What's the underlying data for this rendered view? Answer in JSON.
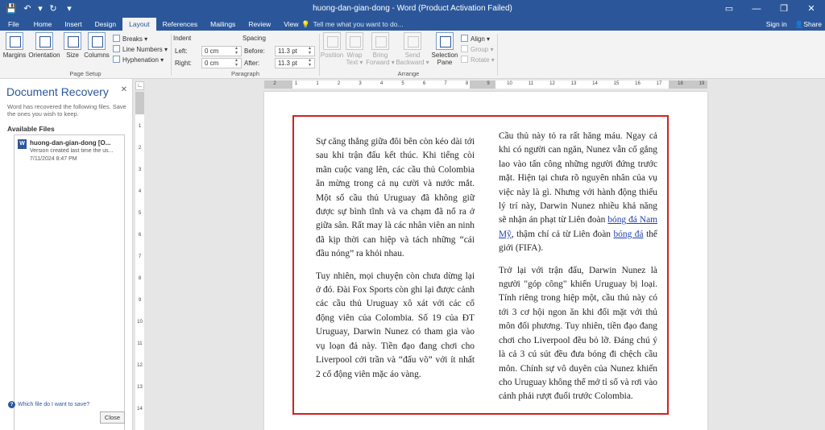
{
  "titlebar": {
    "title": "huong-dan-gian-dong - Word (Product Activation Failed)",
    "qat": {
      "save_glyph": "💾",
      "undo_glyph": "↶",
      "undo_drop": "▾",
      "redo_glyph": "↻",
      "customize_glyph": "▾"
    },
    "controls": {
      "ribbon_opts": "▭",
      "minimize": "—",
      "restore": "❐",
      "close": "✕"
    }
  },
  "tabs": [
    "File",
    "Home",
    "Insert",
    "Design",
    "Layout",
    "References",
    "Mailings",
    "Review",
    "View"
  ],
  "active_tab": "Layout",
  "tell_me": {
    "icon": "💡",
    "text": "Tell me what you want to do..."
  },
  "account": {
    "sign_in": "Sign in",
    "share": "Share",
    "share_icon": "👤"
  },
  "ribbon": {
    "page_setup": {
      "margins": "Margins",
      "orientation": "Orientation",
      "size": "Size",
      "columns": "Columns",
      "breaks": "Breaks ▾",
      "line_numbers": "Line Numbers ▾",
      "hyphenation": "Hyphenation ▾",
      "label": "Page Setup"
    },
    "paragraph": {
      "indent": "Indent",
      "left_label": "Left:",
      "left_value": "0 cm",
      "right_label": "Right:",
      "right_value": "0 cm",
      "spacing": "Spacing",
      "before_label": "Before:",
      "before_value": "11.3 pt",
      "after_label": "After:",
      "after_value": "11.3 pt",
      "label": "Paragraph"
    },
    "arrange": {
      "position": "Position",
      "wrap_text_1": "Wrap",
      "wrap_text_2": "Text ▾",
      "bring_forward_1": "Bring",
      "bring_forward_2": "Forward ▾",
      "send_backward_1": "Send",
      "send_backward_2": "Backward ▾",
      "selection_pane_1": "Selection",
      "selection_pane_2": "Pane",
      "align": "Align ▾",
      "group": "Group ▾",
      "rotate": "Rotate ▾",
      "label": "Arrange"
    }
  },
  "recovery": {
    "title": "Document Recovery",
    "close_glyph": "✕",
    "description": "Word has recovered the following files.  Save the ones you wish to keep.",
    "available": "Available Files",
    "file": {
      "icon": "W",
      "name": "huong-dan-gian-dong  [O...",
      "version": "Version created last time the us...",
      "date": "7/11/2024 8:47 PM"
    },
    "which_icon": "?",
    "which_link": "Which file do I want to save?",
    "close_button": "Close"
  },
  "ruler": {
    "tab_selector": "∟",
    "h_numbers": [
      "2",
      "1",
      "1",
      "2",
      "3",
      "4",
      "5",
      "6",
      "7",
      "8",
      "9",
      "10",
      "11",
      "12",
      "13",
      "14",
      "15",
      "16",
      "17",
      "18",
      "19"
    ],
    "v_numbers": [
      "1",
      "2",
      "3",
      "4",
      "5",
      "6",
      "7",
      "8",
      "9",
      "10",
      "11",
      "12",
      "13",
      "14"
    ]
  },
  "document": {
    "col1_p1": "Sự căng thẳng giữa đôi bên còn kéo dài tới sau khi trận đấu kết thúc. Khi tiếng còi mãn cuộc vang lên, các cầu thủ Colombia ăn mừng trong cả nụ cười và nước mắt. Một số cầu thủ Uruguay đã không giữ được sự bình tĩnh và va chạm đã nổ ra ở giữa sân. Rất may là các nhân viên an ninh đã kịp thời can hiệp và tách những “cái đầu nóng” ra khỏi nhau.",
    "col1_p2": "Tuy nhiên, mọi chuyện còn chưa dừng lại ở đó. Đài Fox Sports còn ghi lại được cảnh các cầu thủ Uruguay xô xát với các cổ động viên của Colombia. Số 19 của ĐT Uruguay, Darwin Nunez có tham gia vào vụ loạn đả này. Tiền đạo đang chơi cho Liverpool cởi trần và “đấu võ” với ít nhất 2 cổ động viên mặc áo vàng.",
    "col2_p1_a": "Cầu thủ này tỏ ra rất hăng máu. Ngay cả khi có người can ngăn, Nunez vẫn cố gắng lao vào tấn công những người đứng trước mặt. Hiện tại chưa rõ nguyên nhân của vụ việc này là gì. Nhưng với hành động thiếu lý trí này, Darwin Nunez nhiều khả năng sẽ nhận án phạt từ Liên đoàn ",
    "col2_link1": "bóng đá Nam Mỹ",
    "col2_p1_b": ", thậm chí cả từ Liên đoàn ",
    "col2_link2": "bóng đá",
    "col2_p1_c": " thế giới (FIFA).",
    "col2_p2": "Trở lại với trận đấu, Darwin Nunez là người \"góp công\" khiến Uruguay bị loại. Tính riêng trong hiệp một, cầu thủ này có tới 3 cơ hội ngon ăn khi đối mặt với thủ môn đối phương. Tuy nhiên, tiền đạo đang chơi cho Liverpool đều bỏ lỡ. Đáng chú ý là cả 3 cú sút đều đưa bóng đi chệch cầu môn. Chính sự vô duyên của Nunez khiến cho Uruguay không thể mở tỉ số và rơi vào cảnh phải rượt đuổi trước Colombia."
  }
}
